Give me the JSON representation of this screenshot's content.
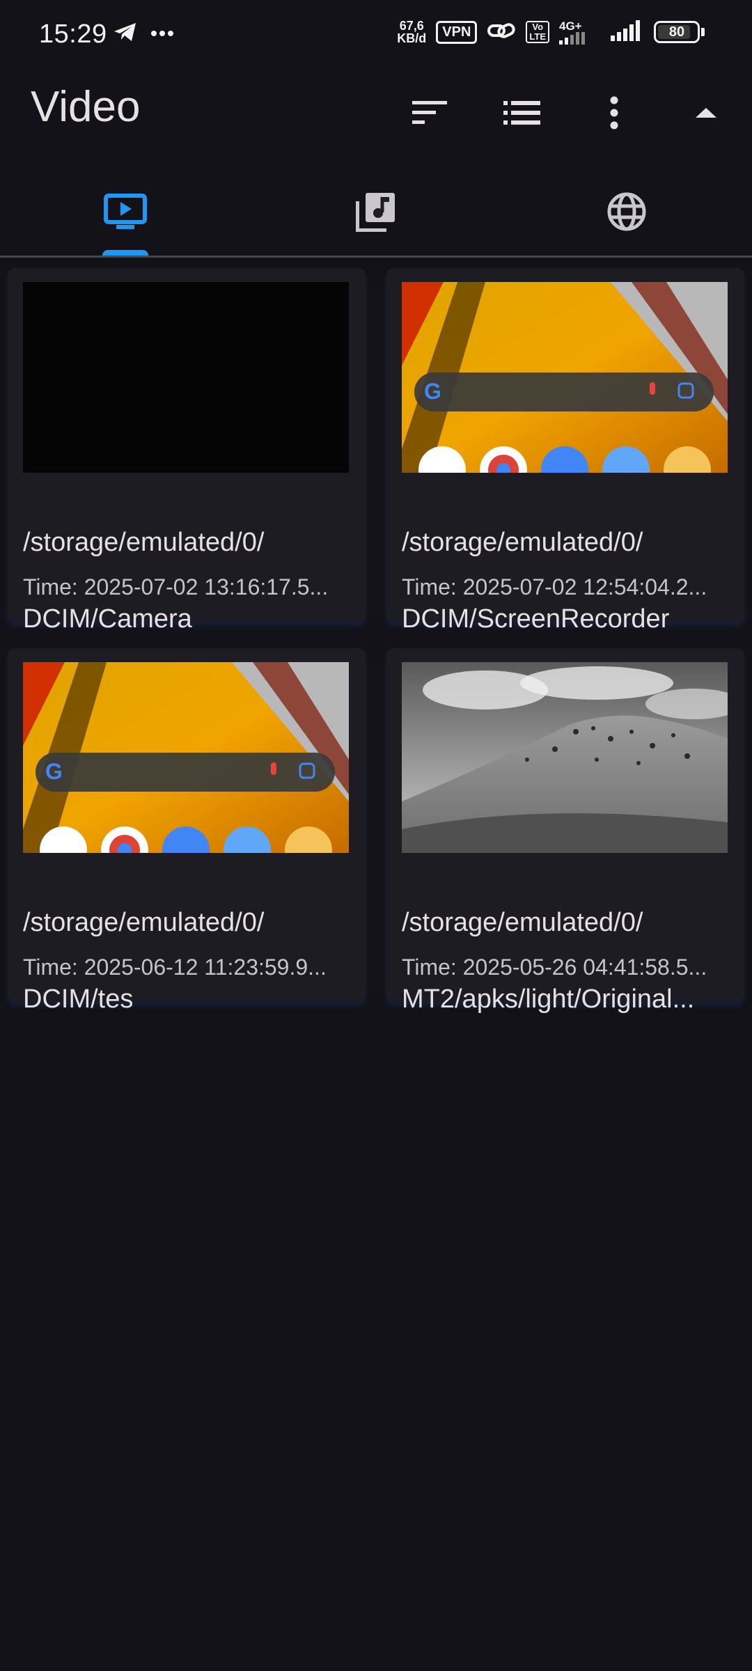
{
  "status_bar": {
    "time": "15:29",
    "speed_value": "67,6",
    "speed_unit": "KB/d",
    "vpn": "VPN",
    "volte_top": "Vo",
    "volte_bottom": "LTE",
    "network": "4G+",
    "battery": "80",
    "icons": [
      "telegram-icon",
      "more-dots-icon",
      "link-icon",
      "signal-icon"
    ]
  },
  "app_bar": {
    "title": "Video",
    "actions": [
      "sort-icon",
      "list-view-icon",
      "more-vert-icon",
      "collapse-arrow-icon"
    ]
  },
  "tabs": [
    {
      "icon": "video-tab-icon",
      "active": true
    },
    {
      "icon": "music-library-icon",
      "active": false
    },
    {
      "icon": "globe-icon",
      "active": false
    }
  ],
  "colors": {
    "background": "#131218",
    "card": "#1d1c22",
    "accent": "#2196f3"
  },
  "videos": [
    {
      "line1": "/storage/emulated/0/",
      "line2": "DCIM/Camera",
      "time": "Time: 2025-07-02 13:16:17.5...",
      "thumb": "black"
    },
    {
      "line1": "/storage/emulated/0/",
      "line2": "DCIM/ScreenRecorder",
      "time": "Time: 2025-07-02 12:54:04.2...",
      "thumb": "homescreen"
    },
    {
      "line1": "/storage/emulated/0/",
      "line2": "DCIM/tes",
      "time": "Time: 2025-06-12 11:23:59.9...",
      "thumb": "homescreen"
    },
    {
      "line1": "/storage/emulated/0/",
      "line2": "MT2/apks/light/Original...",
      "time": "Time: 2025-05-26 04:41:58.5...",
      "thumb": "landscape"
    }
  ]
}
